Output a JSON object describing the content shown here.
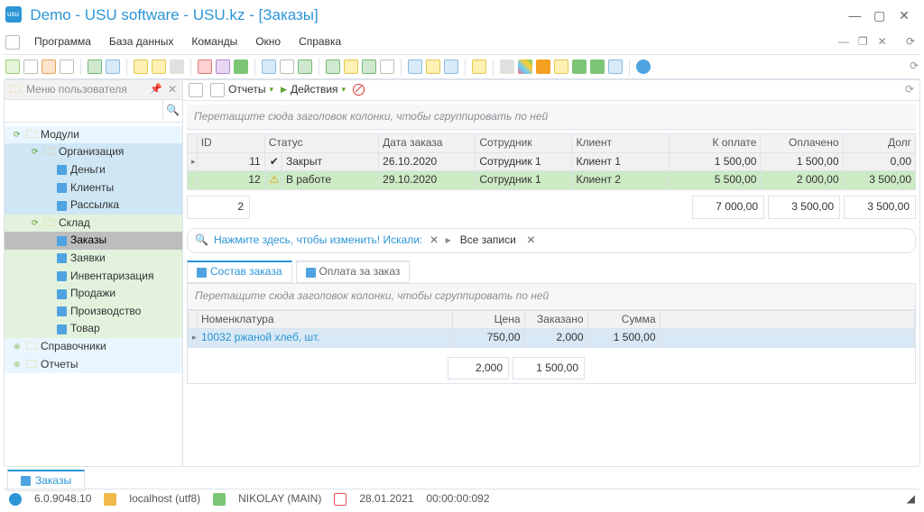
{
  "title": "Demo - USU software - USU.kz - [Заказы]",
  "menu": {
    "program": "Программа",
    "database": "База данных",
    "commands": "Команды",
    "window": "Окно",
    "help": "Справка"
  },
  "sidebar": {
    "header": "Меню пользователя",
    "items": {
      "modules": "Модули",
      "organization": "Организация",
      "money": "Деньги",
      "clients": "Клиенты",
      "mailing": "Рассылка",
      "warehouse": "Склад",
      "orders": "Заказы",
      "requests": "Заявки",
      "inventory": "Инвентаризация",
      "sales": "Продажи",
      "production": "Производство",
      "goods": "Товар",
      "directories": "Справочники",
      "reports": "Отчеты"
    }
  },
  "main_tb": {
    "reports": "Отчеты",
    "actions": "Действия"
  },
  "group_hint": "Перетащите сюда заголовок колонки, чтобы сгруппировать по ней",
  "orders": {
    "cols": {
      "id": "ID",
      "status": "Статус",
      "date": "Дата заказа",
      "employee": "Сотрудник",
      "client": "Клиент",
      "to_pay": "К оплате",
      "paid": "Оплачено",
      "debt": "Долг"
    },
    "rows": [
      {
        "id": "11",
        "status": "Закрыт",
        "status_icon": "✓",
        "date": "26.10.2020",
        "employee": "Сотрудник 1",
        "client": "Клиент 1",
        "to_pay": "1 500,00",
        "paid": "1 500,00",
        "debt": "0,00",
        "cls": "row-gray"
      },
      {
        "id": "12",
        "status": "В работе",
        "status_icon": "!",
        "date": "29.10.2020",
        "employee": "Сотрудник 1",
        "client": "Клиент 2",
        "to_pay": "5 500,00",
        "paid": "2 000,00",
        "debt": "3 500,00",
        "cls": "row-green"
      }
    ],
    "totals": {
      "count": "2",
      "to_pay": "7 000,00",
      "paid": "3 500,00",
      "debt": "3 500,00"
    }
  },
  "search": {
    "prompt": "Нажмите здесь, чтобы изменить! Искали:",
    "chip": "Все записи"
  },
  "subtabs": {
    "content": "Состав заказа",
    "payment": "Оплата за заказ"
  },
  "lines": {
    "cols": {
      "nom": "Номенклатура",
      "price": "Цена",
      "qty": "Заказано",
      "sum": "Сумма"
    },
    "rows": [
      {
        "nom": "10032 ржаной хлеб, шт.",
        "price": "750,00",
        "qty": "2,000",
        "sum": "1 500,00"
      }
    ],
    "totals": {
      "qty": "2,000",
      "sum": "1 500,00"
    }
  },
  "doc_tab": "Заказы",
  "status": {
    "version": "6.0.9048.10",
    "db": "localhost (utf8)",
    "user": "NIKOLAY (MAIN)",
    "date": "28.01.2021",
    "timer": "00:00:00:092"
  }
}
